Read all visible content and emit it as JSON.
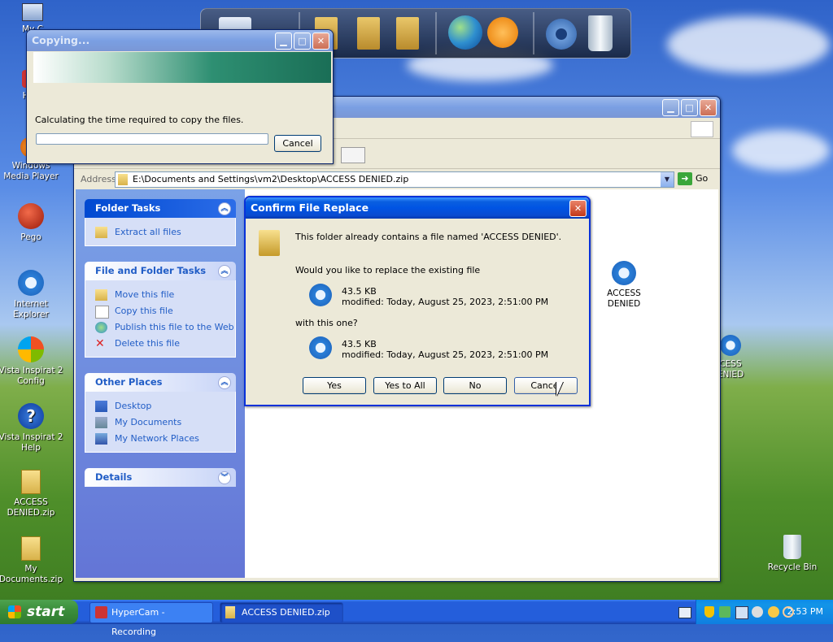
{
  "desktop": {
    "icons": [
      {
        "label": "My C"
      },
      {
        "label": "Hyp"
      },
      {
        "label": "Windows Media Player"
      },
      {
        "label": "Pego"
      },
      {
        "label": "Internet Explorer"
      },
      {
        "label": "Vista Inspirat 2 Config"
      },
      {
        "label": "Vista Inspirat 2 Help"
      },
      {
        "label": "ACCESS DENIED.zip"
      },
      {
        "label": "My Documents.zip"
      },
      {
        "label": "Recycle Bin"
      },
      {
        "label": "CESS ENIED"
      }
    ]
  },
  "copying_dialog": {
    "title": "Copying...",
    "status": "Calculating the time required to copy the files.",
    "progress": 0,
    "cancel_label": "Cancel"
  },
  "explorer": {
    "address_label": "Address",
    "address_value": "E:\\Documents and Settings\\vm2\\Desktop\\ACCESS DENIED.zip",
    "go_label": "Go",
    "folder_tasks": {
      "title": "Folder Tasks",
      "items": [
        "Extract all files"
      ]
    },
    "file_folder_tasks": {
      "title": "File and Folder Tasks",
      "items": [
        "Move this file",
        "Copy this file",
        "Publish this file to the Web",
        "Delete this file"
      ]
    },
    "other_places": {
      "title": "Other Places",
      "items": [
        "Desktop",
        "My Documents",
        "My Network Places"
      ]
    },
    "details": {
      "title": "Details"
    },
    "file_item": {
      "label": "ACCESS DENIED"
    }
  },
  "confirm_dialog": {
    "title": "Confirm File Replace",
    "message": "This folder already contains a file named 'ACCESS DENIED'.",
    "question": "Would you like to replace the existing file",
    "existing_size": "43.5 KB",
    "existing_modified": "modified: Today, August 25, 2023, 2:51:00 PM",
    "with_text": "with this one?",
    "new_size": "43.5 KB",
    "new_modified": "modified: Today, August 25, 2023, 2:51:00 PM",
    "buttons": {
      "yes": "Yes",
      "yes_all": "Yes to All",
      "no": "No",
      "cancel": "Cancel"
    }
  },
  "taskbar": {
    "start_label": "start",
    "tasks": [
      {
        "label": "HyperCam - Recording"
      },
      {
        "label": "ACCESS DENIED.zip"
      }
    ],
    "clock": "2:53 PM"
  },
  "colors": {
    "xp_blue": "#0054e3",
    "task_link": "#215dc6",
    "desktop_green": "#4f8f2a"
  }
}
